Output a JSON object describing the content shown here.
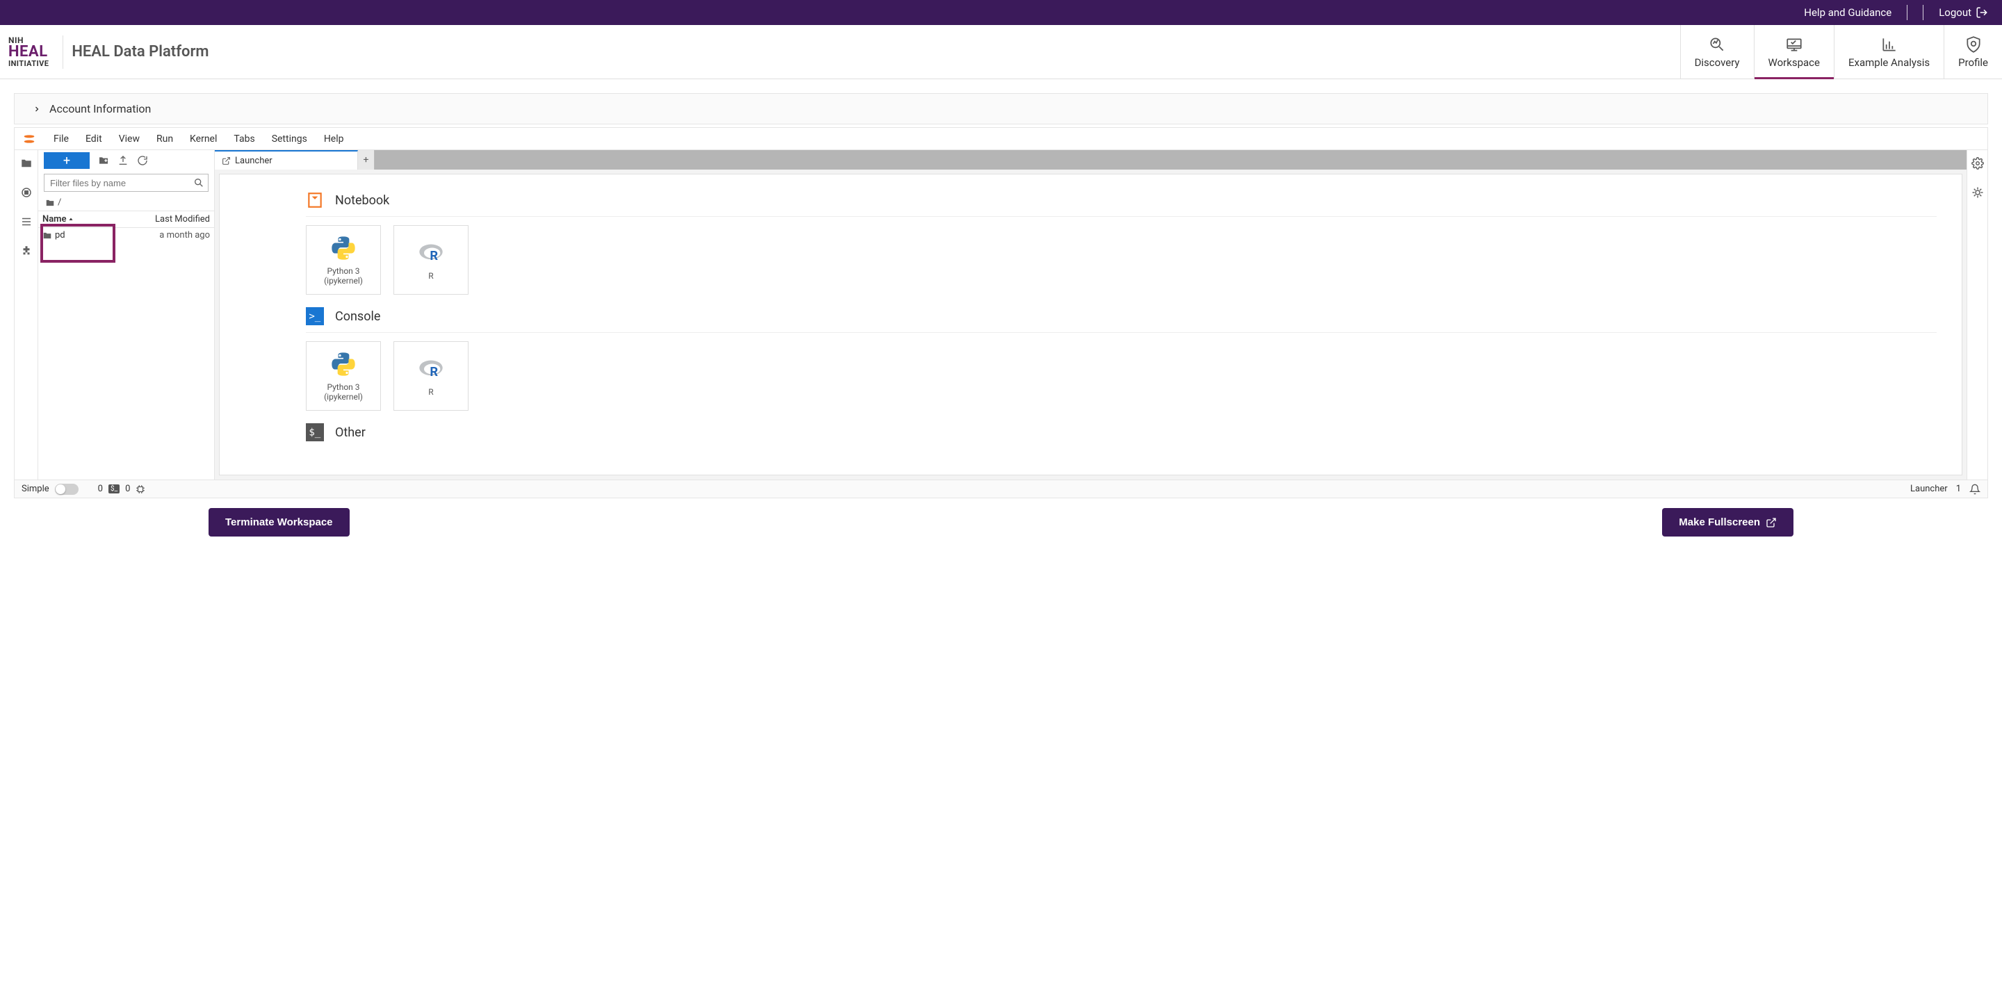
{
  "topbar": {
    "help": "Help and Guidance",
    "logout": "Logout"
  },
  "header": {
    "logo_nih": "NIH",
    "logo_heal": "HEAL",
    "logo_init": "INITIATIVE",
    "platform_title": "HEAL Data Platform",
    "nav": {
      "discovery": "Discovery",
      "workspace": "Workspace",
      "example": "Example Analysis",
      "profile": "Profile"
    }
  },
  "account_bar": "Account Information",
  "jupyter": {
    "menus": [
      "File",
      "Edit",
      "View",
      "Run",
      "Kernel",
      "Tabs",
      "Settings",
      "Help"
    ],
    "filter_placeholder": "Filter files by name",
    "breadcrumb": "/",
    "columns": {
      "name": "Name",
      "modified": "Last Modified"
    },
    "files": [
      {
        "name": "pd",
        "modified": "a month ago",
        "type": "folder"
      }
    ],
    "tab_launcher": "Launcher",
    "sections": {
      "notebook": "Notebook",
      "console": "Console",
      "other": "Other"
    },
    "kernels": {
      "python": "Python 3\n(ipykernel)",
      "r": "R"
    },
    "status": {
      "simple": "Simple",
      "terminals": "0",
      "kernels_count": "0",
      "right_launcher": "Launcher",
      "right_num": "1"
    }
  },
  "actions": {
    "terminate": "Terminate Workspace",
    "fullscreen": "Make Fullscreen"
  }
}
